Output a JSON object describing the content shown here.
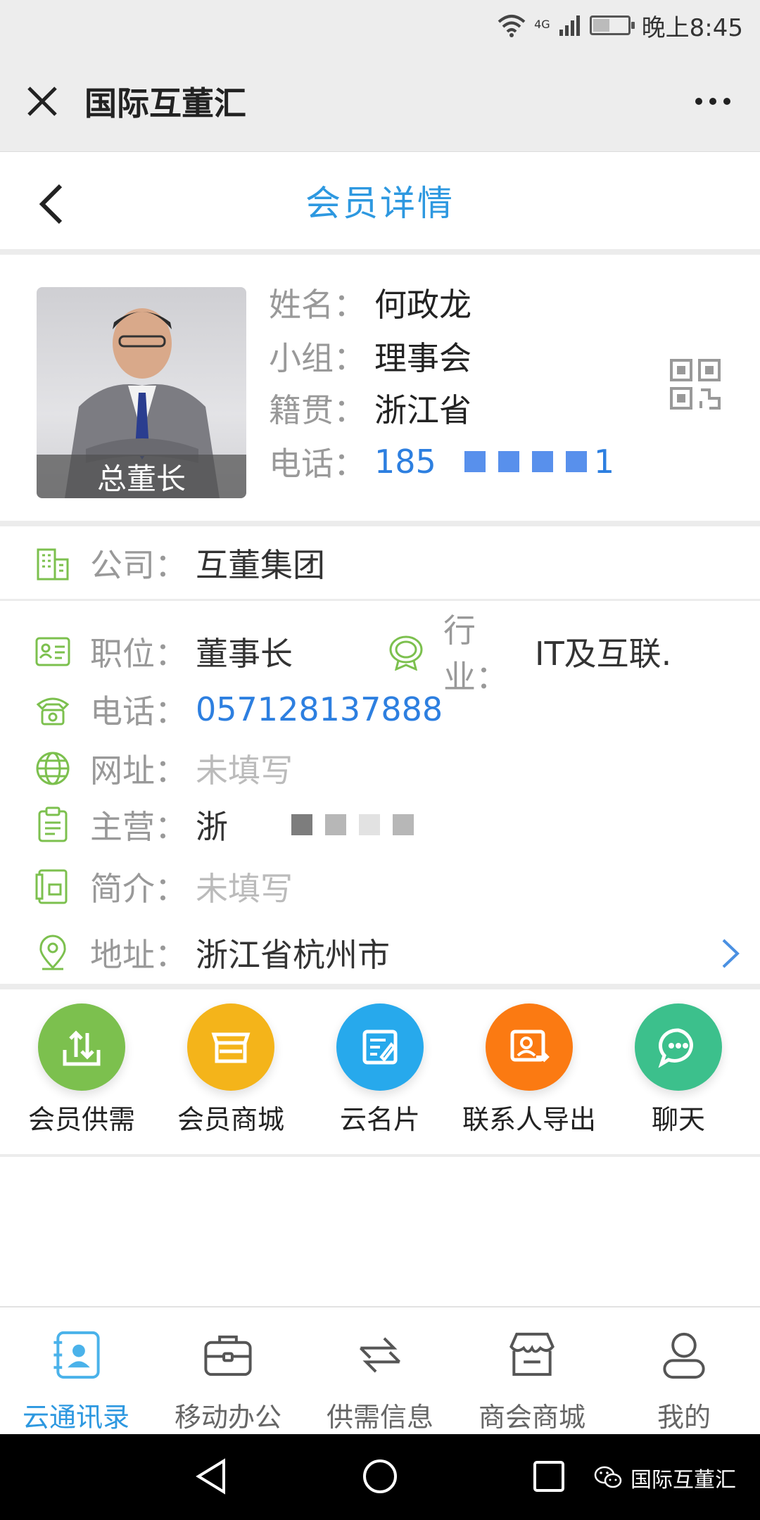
{
  "status_bar": {
    "network": "4G",
    "time": "晚上8:45"
  },
  "wechat_bar": {
    "title": "国际互董汇"
  },
  "page": {
    "title": "会员详情"
  },
  "profile": {
    "photo_role": "总董长",
    "name_label": "姓名：",
    "name": "何政龙",
    "group_label": "小组：",
    "group": "理事会",
    "origin_label": "籍贯：",
    "origin": "浙江省",
    "phone_label": "电话：",
    "phone": "185",
    "phone_tail": "1"
  },
  "company": {
    "label": "公司：",
    "value": "互董集团"
  },
  "details": {
    "position_label": "职位：",
    "position": "董事长",
    "industry_label": "行业：",
    "industry": "IT及互联.",
    "phone_label": "电话：",
    "phone": "057128137888",
    "website_label": "网址：",
    "website": "未填写",
    "business_label": "主营：",
    "business": "浙",
    "intro_label": "简介：",
    "intro": "未填写",
    "address_label": "地址：",
    "address": "浙江省杭州市"
  },
  "actions": [
    {
      "label": "会员供需",
      "color": "#7cc04e"
    },
    {
      "label": "会员商城",
      "color": "#f4b41a"
    },
    {
      "label": "云名片",
      "color": "#27a9ec"
    },
    {
      "label": "联系人导出",
      "color": "#fb7a12"
    },
    {
      "label": "聊天",
      "color": "#3cc08c"
    }
  ],
  "tabs": [
    {
      "label": "云通讯录",
      "active": true
    },
    {
      "label": "移动办公"
    },
    {
      "label": "供需信息"
    },
    {
      "label": "商会商城"
    },
    {
      "label": "我的"
    }
  ],
  "watermark": {
    "text": "国际互董汇"
  },
  "colors": {
    "accent": "#2d98e0",
    "icon_green": "#7cc04e",
    "link_blue": "#2d7fe0"
  }
}
